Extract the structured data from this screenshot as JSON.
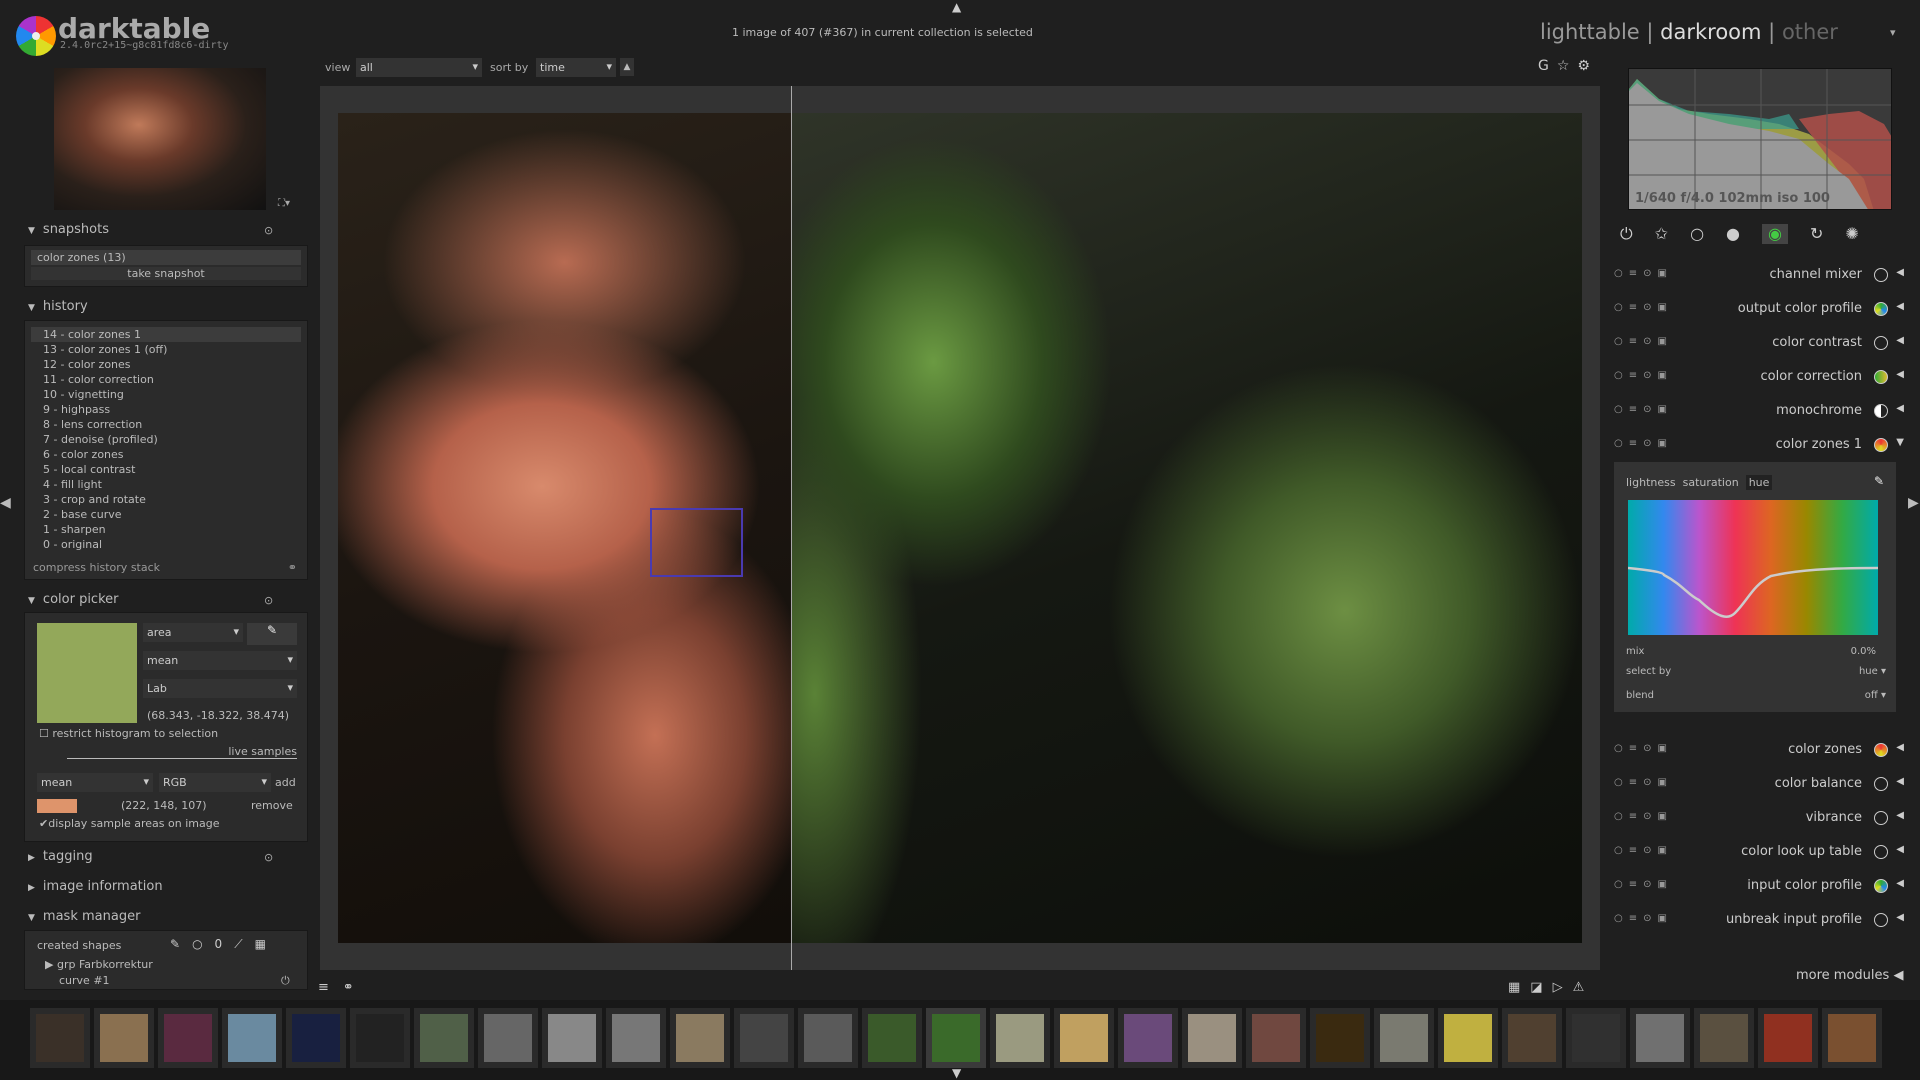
{
  "app": {
    "name": "darktable",
    "version": "2.4.0rc2+15~g8c81fd8c6-dirty"
  },
  "header": {
    "status": "1 image of 407 (#367) in current collection is selected",
    "views": [
      "lighttable",
      "darkroom",
      "other"
    ],
    "active_view": "darkroom"
  },
  "topbar": {
    "view_label": "view",
    "view_value": "all",
    "sort_label": "sort by",
    "sort_value": "time"
  },
  "left": {
    "snapshots": {
      "title": "snapshots",
      "item": "color zones (13)",
      "take": "take snapshot"
    },
    "history": {
      "title": "history",
      "items": [
        "14 - color zones 1",
        "13 - color zones 1 (off)",
        "12 - color zones",
        "11 - color correction",
        "10 - vignetting",
        "9 - highpass",
        "8 - lens correction",
        "7 - denoise (profiled)",
        "6 - color zones",
        "5 - local contrast",
        "4 - fill light",
        "3 - crop and rotate",
        "2 - base curve",
        "1 - sharpen",
        "0 - original"
      ],
      "compress": "compress history stack"
    },
    "color_picker": {
      "title": "color picker",
      "mode": "area",
      "stat": "mean",
      "space": "Lab",
      "value": "(68.343, -18.322, 38.474)",
      "swatch": "#93a85a",
      "restrict": "restrict histogram to selection",
      "live": "live samples",
      "live_stat": "mean",
      "live_space": "RGB",
      "add": "add",
      "remove": "remove",
      "sample_value": "(222, 148, 107)",
      "sample_swatch": "#de946b",
      "display": "display sample areas on image"
    },
    "tagging": "tagging",
    "image_information": "image information",
    "mask_manager": {
      "title": "mask manager",
      "created": "created shapes",
      "group": "grp Farbkorrektur",
      "curve": "curve #1"
    }
  },
  "right": {
    "exif": "1/640 f/4.0 102mm iso 100",
    "modules": [
      {
        "name": "channel mixer",
        "icon": "channel-mixer-icon"
      },
      {
        "name": "output color profile",
        "icon": "color-profile-icon"
      },
      {
        "name": "color contrast",
        "icon": "circle-icon"
      },
      {
        "name": "color correction",
        "icon": "color-correction-icon"
      },
      {
        "name": "monochrome",
        "icon": "monochrome-icon"
      },
      {
        "name": "color zones 1",
        "icon": "color-zones-icon"
      }
    ],
    "color_zones": {
      "tabs": [
        "lightness",
        "saturation",
        "hue"
      ],
      "active_tab": "hue",
      "mix_label": "mix",
      "mix_value": "0.0%",
      "select_label": "select by",
      "select_value": "hue",
      "blend_label": "blend",
      "blend_value": "off"
    },
    "modules2": [
      {
        "name": "color zones",
        "icon": "color-zones-icon"
      },
      {
        "name": "color balance",
        "icon": "circle-icon"
      },
      {
        "name": "vibrance",
        "icon": "circle-icon"
      },
      {
        "name": "color look up table",
        "icon": "circle-icon"
      },
      {
        "name": "input color profile",
        "icon": "color-profile-icon"
      },
      {
        "name": "unbreak input profile",
        "icon": "unbreak-icon"
      }
    ],
    "more": "more modules"
  },
  "colors": {
    "accent_sample_box": "#4a3ab0"
  }
}
